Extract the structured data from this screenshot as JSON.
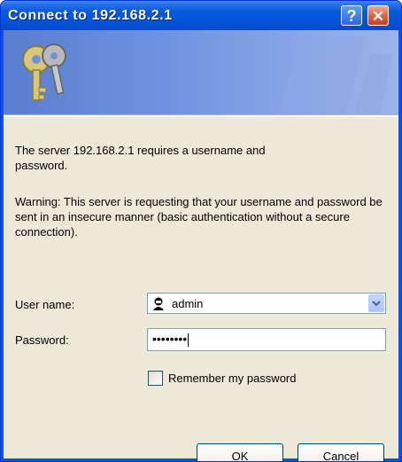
{
  "window": {
    "title": "Connect to 192.168.2.1",
    "help_glyph": "?",
    "close_glyph": "✕"
  },
  "banner": {
    "icon": "keys-icon"
  },
  "message": {
    "line1": "The server 192.168.2.1 requires a username and password.",
    "warning": "Warning: This server is requesting that your username and password be sent in an insecure manner (basic authentication without a secure connection)."
  },
  "form": {
    "username_label": "User name:",
    "username_value": "admin",
    "password_label": "Password:",
    "password_masked": "••••••••",
    "remember_label": "Remember my password",
    "remember_checked": false
  },
  "buttons": {
    "ok": "OK",
    "cancel": "Cancel"
  },
  "colors": {
    "titlebar": "#0453d8",
    "dialog_bg": "#ece9d8",
    "close_button": "#dd5a35"
  }
}
